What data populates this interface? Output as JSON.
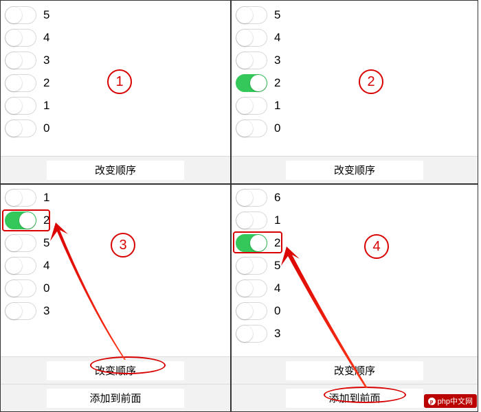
{
  "panels": {
    "one": {
      "badge": "1",
      "items": [
        {
          "label": "5",
          "on": false
        },
        {
          "label": "4",
          "on": false
        },
        {
          "label": "3",
          "on": false
        },
        {
          "label": "2",
          "on": false
        },
        {
          "label": "1",
          "on": false
        },
        {
          "label": "0",
          "on": false
        }
      ],
      "buttons": [
        "改变顺序"
      ]
    },
    "two": {
      "badge": "2",
      "items": [
        {
          "label": "5",
          "on": false
        },
        {
          "label": "4",
          "on": false
        },
        {
          "label": "3",
          "on": false
        },
        {
          "label": "2",
          "on": true
        },
        {
          "label": "1",
          "on": false
        },
        {
          "label": "0",
          "on": false
        }
      ],
      "buttons": [
        "改变顺序"
      ]
    },
    "three": {
      "badge": "3",
      "items": [
        {
          "label": "1",
          "on": false
        },
        {
          "label": "2",
          "on": true
        },
        {
          "label": "5",
          "on": false
        },
        {
          "label": "4",
          "on": false
        },
        {
          "label": "0",
          "on": false
        },
        {
          "label": "3",
          "on": false
        }
      ],
      "buttons": [
        "改变顺序",
        "添加到前面"
      ]
    },
    "four": {
      "badge": "4",
      "items": [
        {
          "label": "6",
          "on": false
        },
        {
          "label": "1",
          "on": false
        },
        {
          "label": "2",
          "on": true
        },
        {
          "label": "5",
          "on": false
        },
        {
          "label": "4",
          "on": false
        },
        {
          "label": "0",
          "on": false
        },
        {
          "label": "3",
          "on": false
        }
      ],
      "buttons": [
        "改变顺序",
        "添加到前面"
      ]
    }
  },
  "watermark": "php中文网",
  "colors": {
    "annotation": "#d80000",
    "toggle_on": "#34C759"
  }
}
